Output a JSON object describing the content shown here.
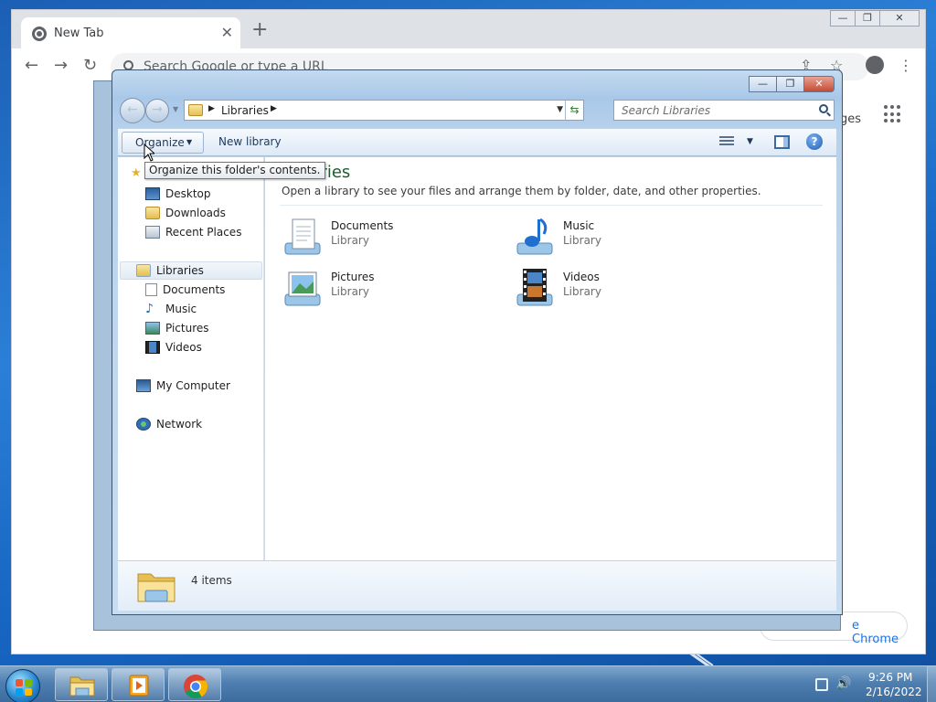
{
  "chrome": {
    "tab_title": "New Tab",
    "tab_close": "✕",
    "new_tab": "+",
    "back": "←",
    "forward": "→",
    "reload": "↻",
    "omnibox_placeholder": "Search Google or type a URL",
    "share": "⇪",
    "bookmark": "☆",
    "menu": "⋮",
    "apps_label": "ges",
    "customize_label": "e Chrome",
    "minimize": "—",
    "restore": "❐",
    "close": "✕"
  },
  "explorer": {
    "caption": {
      "minimize": "—",
      "maximize": "❐",
      "close": "✕"
    },
    "address": {
      "crumb": "Libraries",
      "sep": "▶",
      "drop": "▼",
      "refresh": "⇆"
    },
    "search_placeholder": "Search Libraries",
    "commands": {
      "organize": "Organize",
      "organize_arrow": "▼",
      "new_library": "New library",
      "view_arrow": "▼",
      "help": "?"
    },
    "tooltip": "Organize this folder's contents.",
    "nav": {
      "favorites_star": "★",
      "favorites": [
        {
          "label": "Desktop",
          "icon": "desktop-icon"
        },
        {
          "label": "Downloads",
          "icon": "downloads-icon"
        },
        {
          "label": "Recent Places",
          "icon": "recent-places-icon"
        }
      ],
      "libraries": "Libraries",
      "library_children": [
        {
          "label": "Documents",
          "icon": "documents-icon"
        },
        {
          "label": "Music",
          "icon": "music-icon"
        },
        {
          "label": "Pictures",
          "icon": "pictures-icon"
        },
        {
          "label": "Videos",
          "icon": "videos-icon"
        }
      ],
      "computer": "My Computer",
      "network": "Network"
    },
    "content": {
      "title": "raries",
      "description": "Open a library to see your files and arrange them by folder, date, and other properties.",
      "items": [
        {
          "name": "Documents",
          "type": "Library",
          "icon": "documents-library-icon"
        },
        {
          "name": "Music",
          "type": "Library",
          "icon": "music-library-icon"
        },
        {
          "name": "Pictures",
          "type": "Library",
          "icon": "pictures-library-icon"
        },
        {
          "name": "Videos",
          "type": "Library",
          "icon": "videos-library-icon"
        }
      ]
    },
    "details": {
      "count": "4 items"
    }
  },
  "taskbar": {
    "items": [
      "windows-explorer",
      "media-player",
      "google-chrome"
    ],
    "time": "9:26 PM",
    "date": "2/16/2022",
    "volume": "🔊"
  },
  "colors": {
    "desktop": "#1b5fb5",
    "explorer_frame": "#b8d2ec",
    "library_title": "#1e5a30",
    "link_blue": "#1a73e8"
  }
}
